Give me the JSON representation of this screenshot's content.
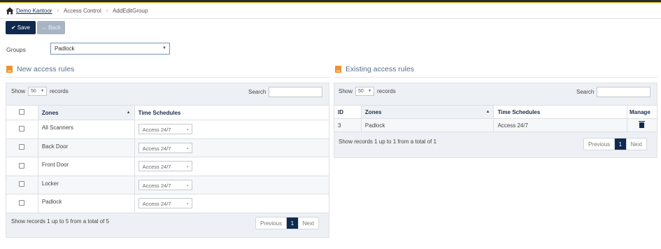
{
  "breadcrumb": {
    "home": "Demo Kantoor",
    "section": "Access Control",
    "page": "AddEditGroup"
  },
  "toolbar": {
    "save_label": "Save",
    "back_label": "Back"
  },
  "groups": {
    "label": "Groups",
    "selected": "Padlock"
  },
  "new_rules": {
    "title": "New access rules",
    "show_label": "Show",
    "page_size": "50",
    "records_label": "records",
    "search_label": "Search",
    "columns": {
      "zones": "Zones",
      "time_schedules": "Time Schedules"
    },
    "rows": [
      {
        "zone": "All Scanners",
        "schedule": "Access 24/7"
      },
      {
        "zone": "Back Door",
        "schedule": "Access 24/7"
      },
      {
        "zone": "Front Door",
        "schedule": "Access 24/7"
      },
      {
        "zone": "Locker",
        "schedule": "Access 24/7"
      },
      {
        "zone": "Padlock",
        "schedule": "Access 24/7"
      }
    ],
    "footer": "Show records 1 up to 5 from a total of 5",
    "pager": {
      "previous": "Previous",
      "current": "1",
      "next": "Next"
    }
  },
  "existing_rules": {
    "title": "Existing access rules",
    "show_label": "Show",
    "page_size": "50",
    "records_label": "records",
    "search_label": "Search",
    "columns": {
      "id": "ID",
      "zones": "Zones",
      "time_schedules": "Time Schedules",
      "manage": "Manage"
    },
    "rows": [
      {
        "id": "3",
        "zone": "Padlock",
        "schedule": "Access 24/7"
      }
    ],
    "footer": "Show records 1 up to 1 from a total of 1",
    "pager": {
      "previous": "Previous",
      "current": "1",
      "next": "Next"
    }
  },
  "colors": {
    "primary": "#0f2a4e",
    "accent": "#f0932b",
    "panel_bg": "#edf0f4"
  }
}
